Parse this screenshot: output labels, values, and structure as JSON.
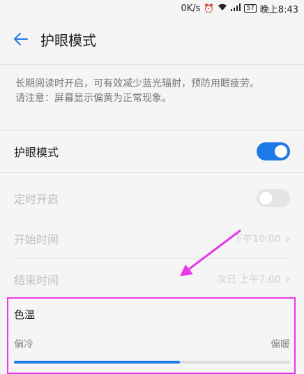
{
  "status_bar": {
    "speed": "0K/s",
    "alarm_icon": "alarm-clock-icon",
    "wifi_icon": "wifi-icon",
    "signal_icon": "signal-icon",
    "battery": "57",
    "time": "晚上8:43"
  },
  "header": {
    "title": "护眼模式"
  },
  "description": {
    "line1": "长期阅读时开启，可有效减少蓝光辐射，预防用眼疲劳。",
    "line2": "请注意：屏幕显示偏黄为正常现象。"
  },
  "eye_mode": {
    "label": "护眼模式",
    "enabled": true
  },
  "schedule": {
    "label": "定时开启",
    "enabled": false
  },
  "start_time": {
    "label": "开始时间",
    "value": "下午10:00"
  },
  "end_time": {
    "label": "结束时间",
    "value": "次日 上午7:00"
  },
  "color_temp": {
    "label": "色温",
    "cool_label": "偏冷",
    "warm_label": "偏暖",
    "level": 0.6
  },
  "colors": {
    "accent": "#1e7ae6",
    "annotation": "#e838e8"
  }
}
